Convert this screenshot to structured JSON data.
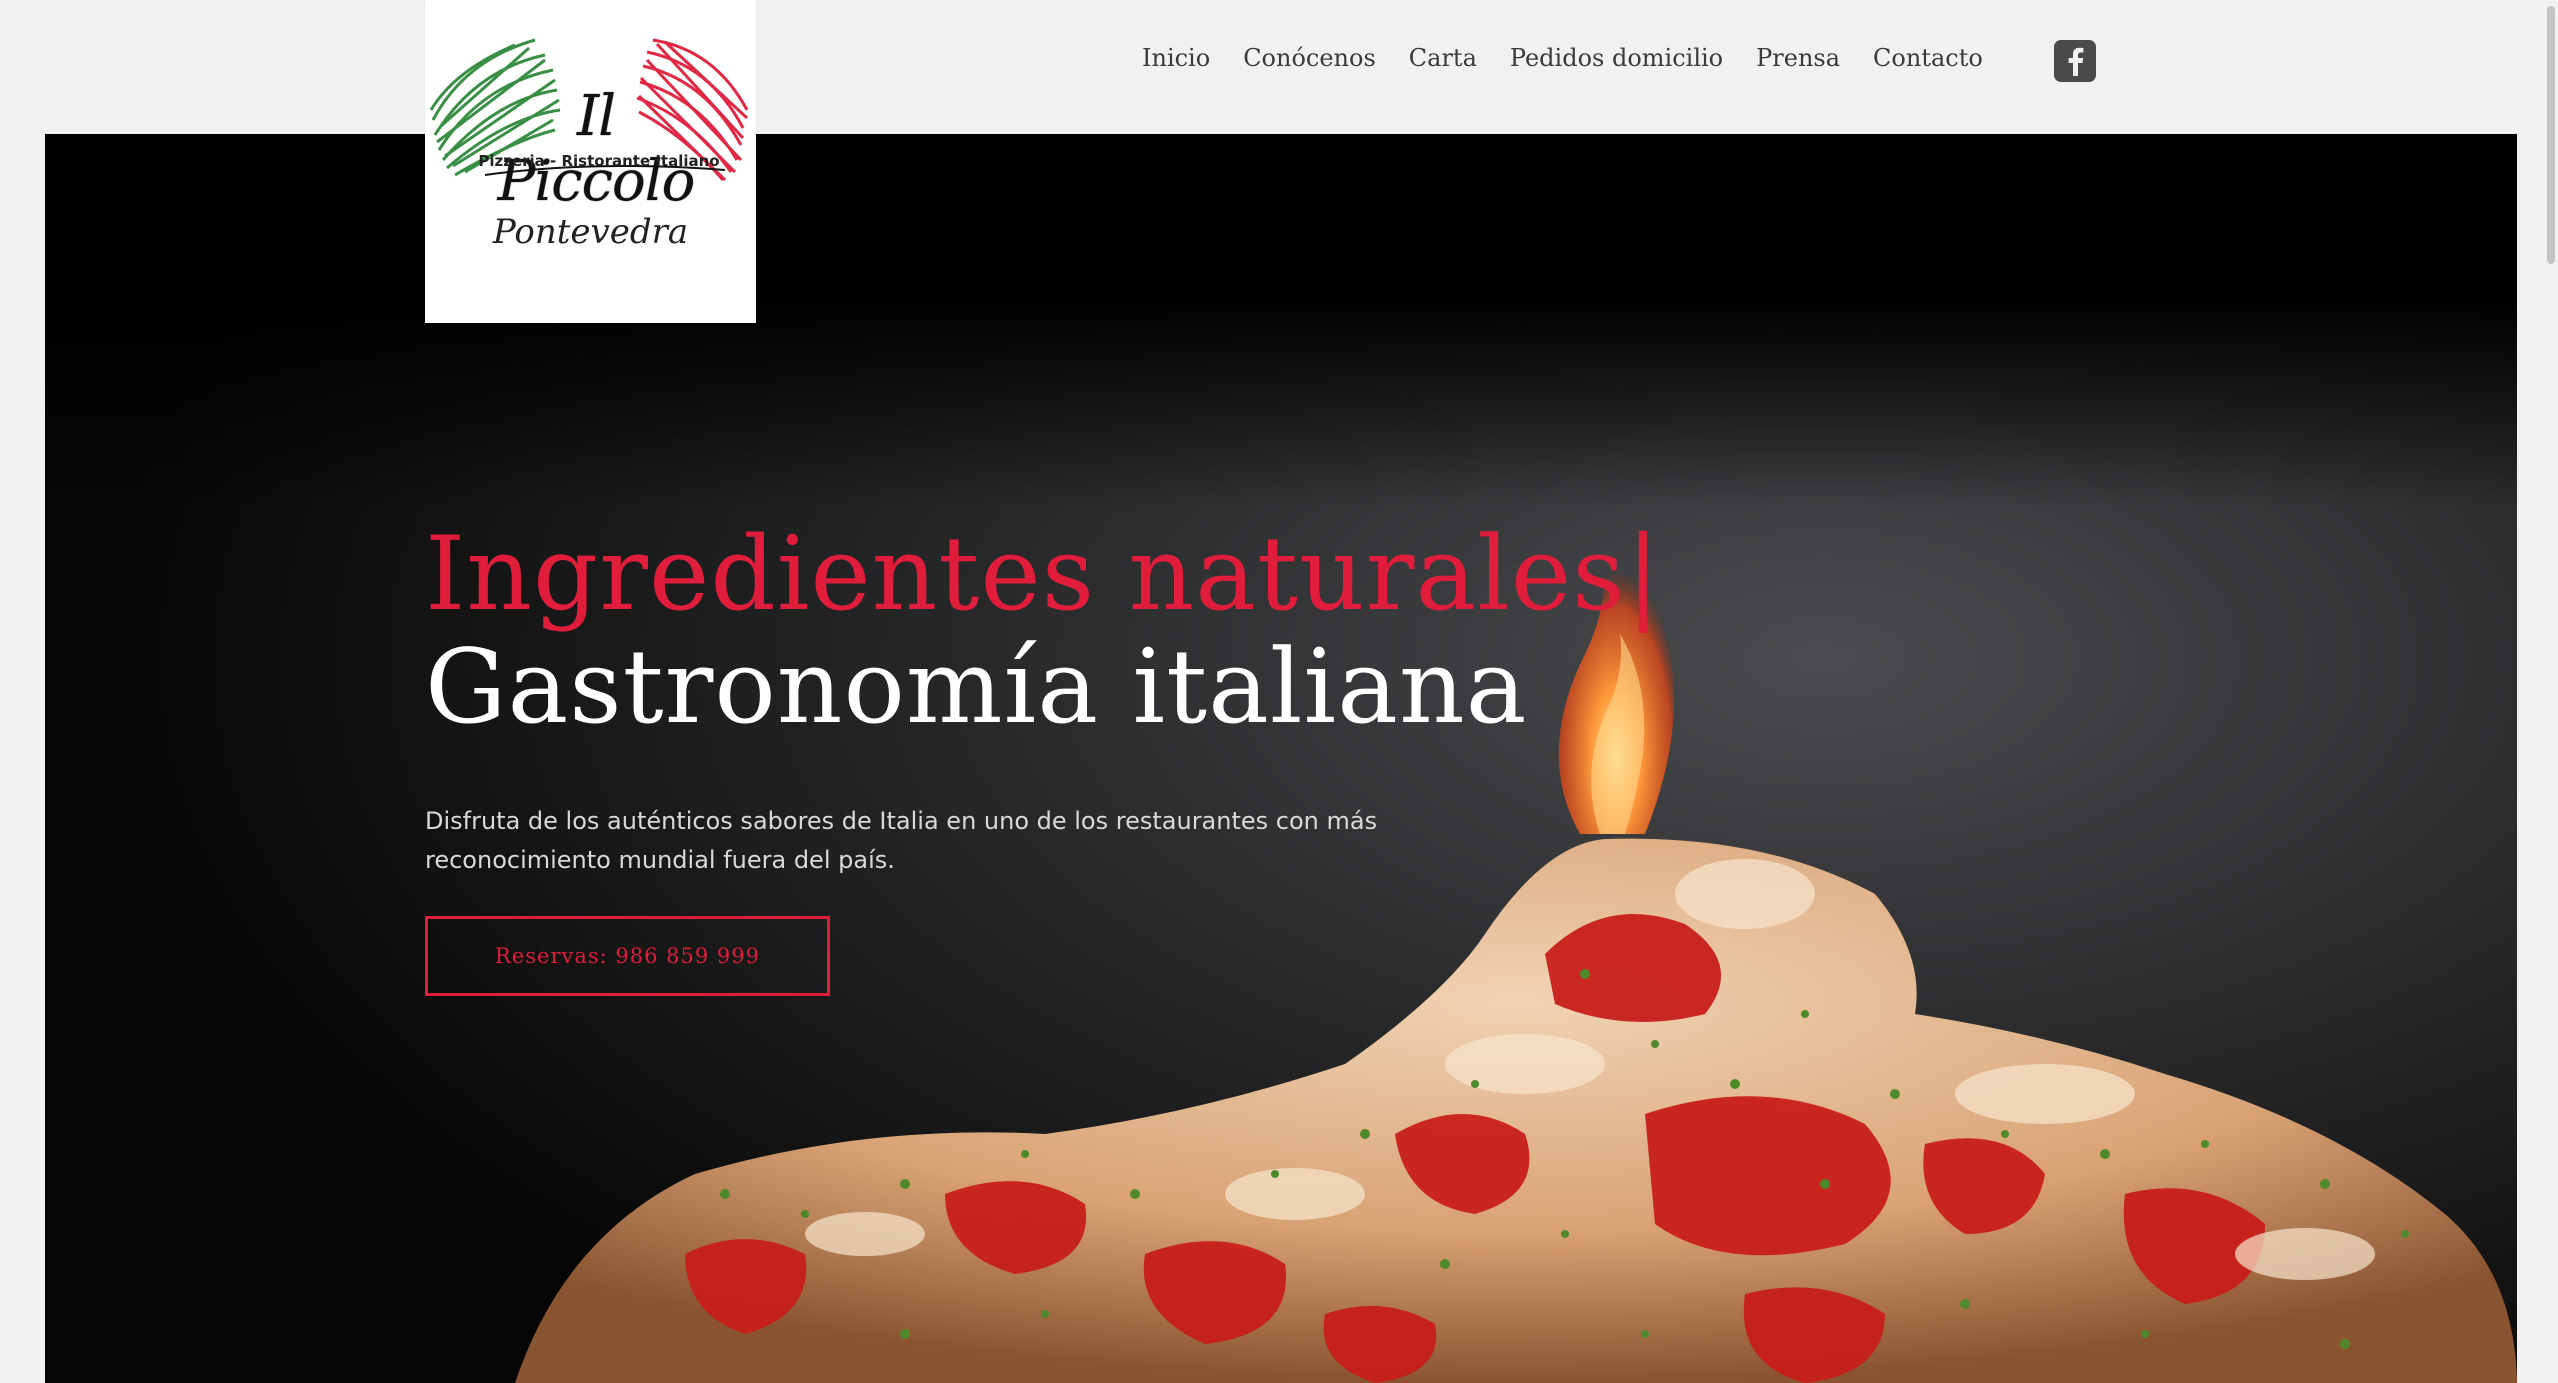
{
  "logo": {
    "brand": "Il Piccolo",
    "tagline": "Pizzeria - Ristorante Italiano",
    "city": "Pontevedra"
  },
  "nav": {
    "items": [
      "Inicio",
      "Conócenos",
      "Carta",
      "Pedidos domicilio",
      "Prensa",
      "Contacto"
    ]
  },
  "social": {
    "icon": "facebook-icon"
  },
  "hero": {
    "headline_1": "Ingredientes naturales|",
    "headline_2": "Gastronomía italiana",
    "description": "Disfruta de los auténticos sabores de Italia en uno de los restaurantes con más reconocimiento mundial fuera del país.",
    "button_label": "Reservas: 986 859 999"
  },
  "colors": {
    "accent": "#e01d3b",
    "nav_text": "#3a3a3a",
    "page_bg": "#f1f1f1",
    "hero_bg": "#000000"
  }
}
